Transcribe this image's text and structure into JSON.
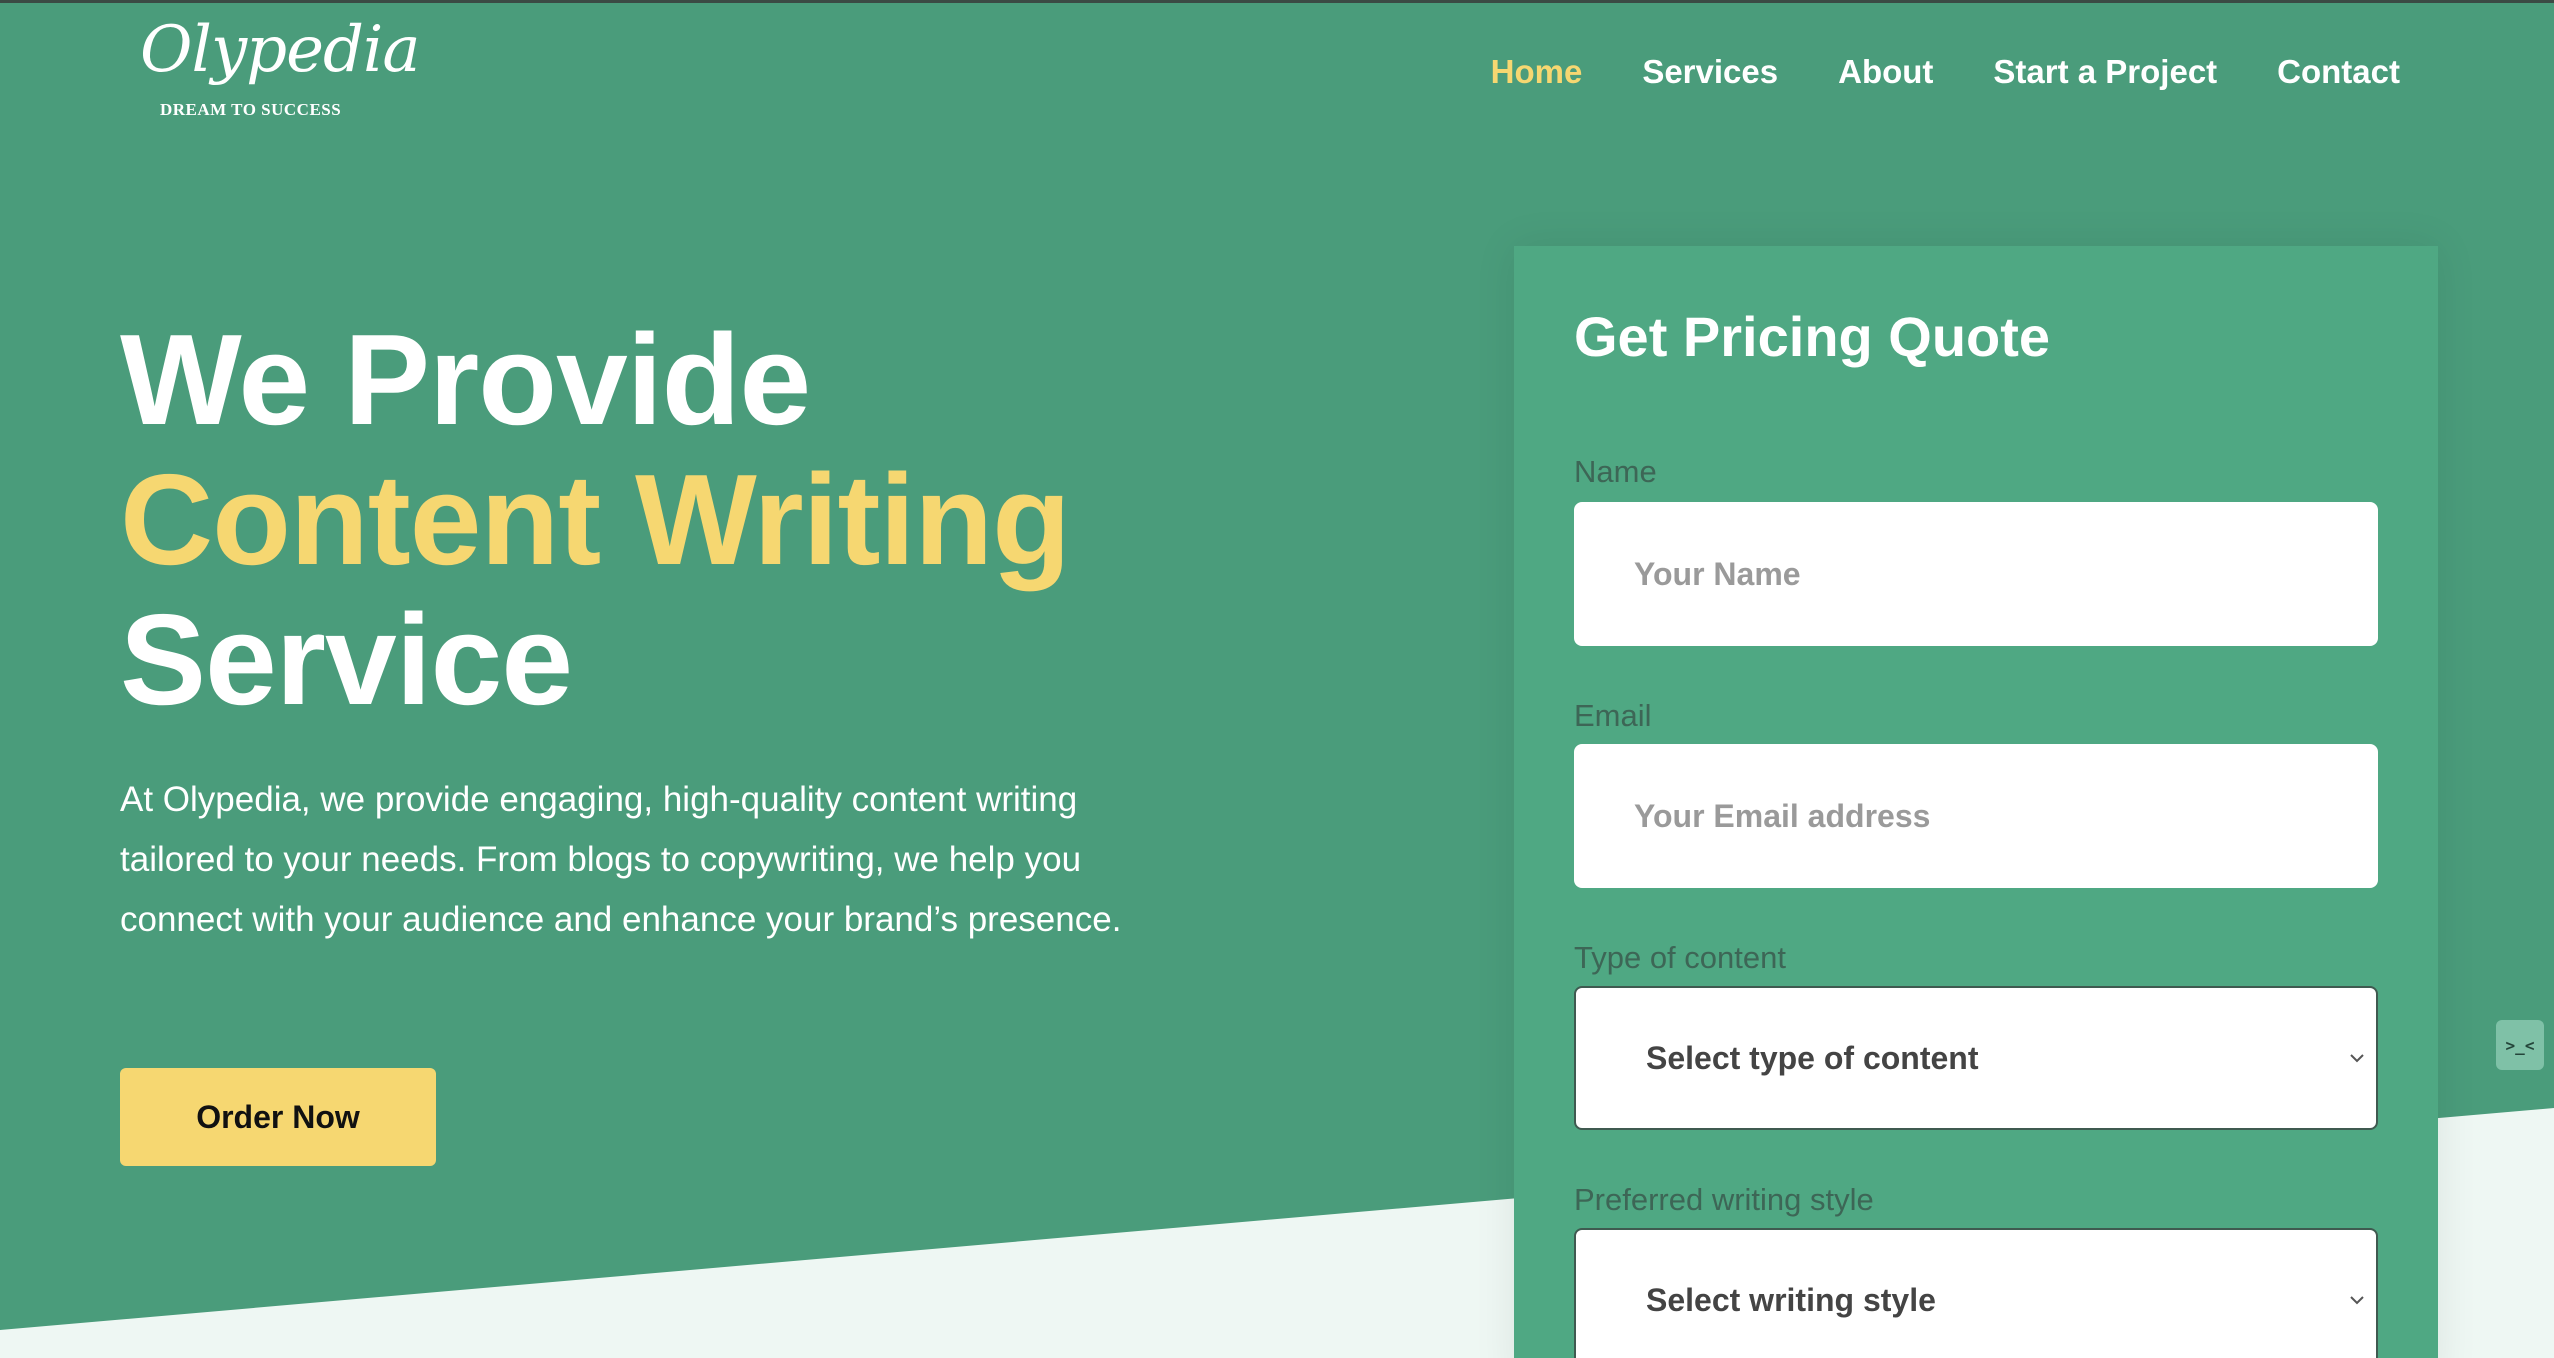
{
  "logo": {
    "name": "Olypedia",
    "tagline": "DREAM TO SUCCESS"
  },
  "nav": [
    {
      "label": "Home",
      "active": true
    },
    {
      "label": "Services",
      "active": false
    },
    {
      "label": "About",
      "active": false
    },
    {
      "label": "Start a Project",
      "active": false
    },
    {
      "label": "Contact",
      "active": false
    }
  ],
  "hero": {
    "title_line1": "We Provide",
    "title_line2": "Content Writing",
    "title_line3": "Service",
    "description": "At Olypedia, we provide engaging, high-quality content writing tailored to your needs. From blogs to copywriting, we help you connect with your audience and enhance your brand’s presence.",
    "cta_label": "Order Now"
  },
  "form": {
    "title": "Get Pricing Quote",
    "name_label": "Name",
    "name_placeholder": "Your Name",
    "email_label": "Email",
    "email_placeholder": "Your Email address",
    "content_type_label": "Type of content",
    "content_type_value": "Select type of content",
    "style_label": "Preferred writing style",
    "style_value": "Select writing style"
  },
  "side_widget": {
    "icon": "chat-bot-icon",
    "text": ">_<"
  },
  "colors": {
    "background": "#4a9c7b",
    "card": "#4fa883",
    "accent": "#f6d771",
    "light_band": "#eef7f3"
  }
}
